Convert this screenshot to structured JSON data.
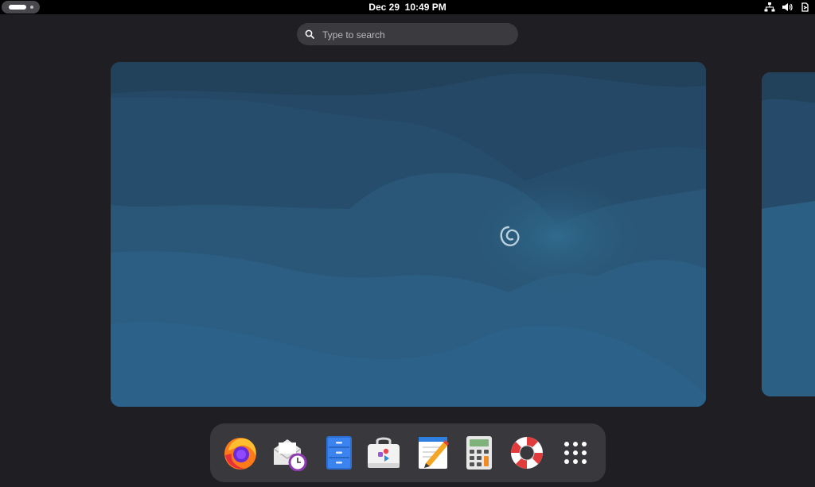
{
  "topbar": {
    "date": "Dec 29",
    "time": "10:49 PM",
    "activities_icon": "activities-pill-icon",
    "tray_icons": [
      "network-wired-icon",
      "volume-icon",
      "power-icon"
    ]
  },
  "search": {
    "placeholder": "Type to search",
    "icon": "search-icon"
  },
  "workspaces": {
    "current": {
      "wallpaper": "debian-swirl-wallpaper",
      "logo": "debian-swirl-logo"
    },
    "next": {
      "wallpaper": "debian-wallpaper-partial"
    }
  },
  "dash": {
    "apps": [
      {
        "name": "Firefox",
        "icon": "firefox-icon"
      },
      {
        "name": "Evolution",
        "icon": "evolution-mail-clock-icon"
      },
      {
        "name": "Files",
        "icon": "files-cabinet-icon"
      },
      {
        "name": "Software",
        "icon": "software-bag-icon"
      },
      {
        "name": "Text Editor",
        "icon": "text-editor-icon"
      },
      {
        "name": "Calculator",
        "icon": "calculator-icon"
      },
      {
        "name": "Help",
        "icon": "lifebuoy-help-icon"
      },
      {
        "name": "Show Applications",
        "icon": "app-grid-icon"
      }
    ]
  },
  "colors": {
    "background": "#1f1f23",
    "topbar": "#000000",
    "search_bg": "#3a3a3f",
    "dash_bg": "#38383d",
    "wallpaper_blue": "#2b5a78"
  }
}
